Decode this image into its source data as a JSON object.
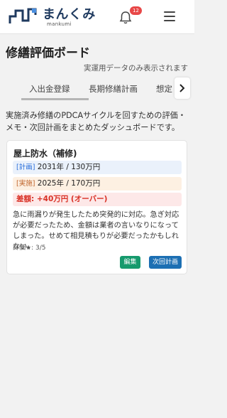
{
  "header": {
    "logo_text": "まんくみ",
    "logo_sub": "mankumi",
    "notification_count": "12"
  },
  "page": {
    "title": "修繕評価ボード",
    "subtitle": "実運用データのみ表示されます"
  },
  "tabs": [
    {
      "label": "入出金登録",
      "active": true
    },
    {
      "label": "長期修繕計画",
      "active": false
    },
    {
      "label": "想定",
      "active": false
    }
  ],
  "description": "実施済み修繕のPDCAサイクルを回すための評価・メモ・次回計画をまとめたダッシュボードです。",
  "card": {
    "title": "屋上防水（補修)",
    "plan_tag": "[計画]",
    "plan_value": "2031年 / 130万円",
    "actual_tag": "[実施]",
    "actual_value": "2025年 / 170万円",
    "diff": "差額: +40万円 (オーバー)",
    "note": "急に雨漏りが発生したため突発的に対応。急ぎ対応が必要だったため、金額は業者の言いなりになってしまった。せめて相見積もりが必要だったかもしれない。",
    "rating": "評価★: 3/5",
    "edit_label": "編集",
    "next_label": "次回計画"
  },
  "colors": {
    "brand": "#1f3a5f",
    "badge": "#e84747",
    "diff": "#d93025",
    "edit_button": "#169a6d",
    "next_button": "#1c6fb3"
  }
}
